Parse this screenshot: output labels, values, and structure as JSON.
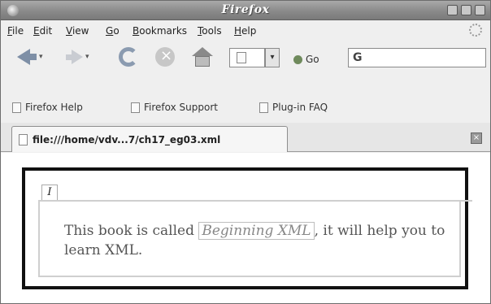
{
  "window": {
    "title": "Firefox"
  },
  "menubar": {
    "items": [
      {
        "mnemonic": "F",
        "rest": "ile"
      },
      {
        "mnemonic": "E",
        "rest": "dit"
      },
      {
        "mnemonic": "V",
        "rest": "iew"
      },
      {
        "mnemonic": "G",
        "rest": "o"
      },
      {
        "mnemonic": "B",
        "rest": "ookmarks"
      },
      {
        "mnemonic": "T",
        "rest": "ools"
      },
      {
        "mnemonic": "H",
        "rest": "elp"
      }
    ]
  },
  "navbar": {
    "go_label": "Go",
    "search_glyph": "G"
  },
  "bookmarks": {
    "items": [
      "Firefox Help",
      "Firefox Support",
      "Plug-in FAQ"
    ]
  },
  "tabs": {
    "active_label": "file:///home/vdv...7/ch17_eg03.xml"
  },
  "content": {
    "legend": "I",
    "text_before": "This book is called ",
    "book_title": "Beginning XML",
    "text_after": ", it will help you to learn XML."
  }
}
